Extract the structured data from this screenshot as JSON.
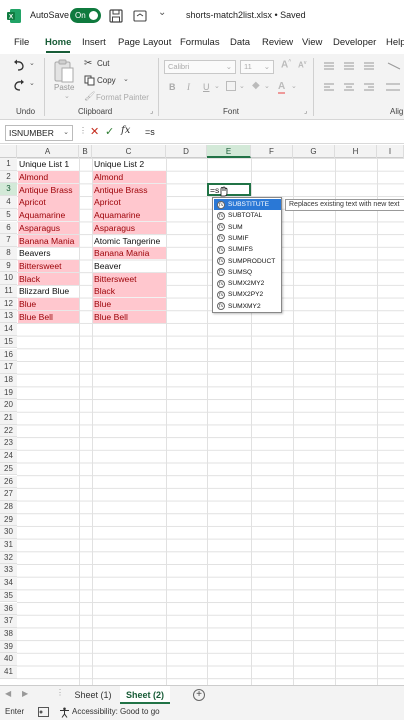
{
  "titlebar": {
    "autosave_label": "AutoSave",
    "toggle_state": "On",
    "doc_title": "shorts-match2list.xlsx • Saved",
    "chevron": "⌄"
  },
  "tabs": [
    "File",
    "Home",
    "Insert",
    "Page Layout",
    "Formulas",
    "Data",
    "Review",
    "View",
    "Developer",
    "Help"
  ],
  "ribbon": {
    "paste_label": "Paste",
    "cut_label": "Cut",
    "copy_label": "Copy",
    "format_painter_label": "Format Painter",
    "font_name": "Calibri",
    "font_size": "11",
    "bold": "B",
    "italic": "I",
    "underline": "U",
    "undo_group": "Undo",
    "clipboard_group": "Clipboard",
    "font_group": "Font",
    "alignment_group": "Alig"
  },
  "formula_bar": {
    "name_box": "ISNUMBER",
    "fx_label": "fx",
    "formula": "=s"
  },
  "columns": [
    "A",
    "B",
    "C",
    "D",
    "E",
    "F",
    "G",
    "H",
    "I"
  ],
  "rows": [
    "1",
    "2",
    "3",
    "4",
    "5",
    "6",
    "7",
    "8",
    "9",
    "10",
    "11",
    "12",
    "13",
    "14",
    "15",
    "16",
    "17",
    "18",
    "19",
    "20",
    "21",
    "22",
    "23",
    "24",
    "25",
    "26",
    "27",
    "28",
    "29",
    "30",
    "31",
    "32",
    "33",
    "34",
    "35",
    "36",
    "37",
    "38",
    "39",
    "40",
    "41"
  ],
  "cells": {
    "a1": "Unique List 1",
    "a2": "Almond",
    "a3": "Antique Brass",
    "a4": "Apricot",
    "a5": "Aquamarine",
    "a6": "Asparagus",
    "a7": "Banana Mania",
    "a8": "Beavers",
    "a9": "Bittersweet",
    "a10": "Black",
    "a11": "Blizzard Blue",
    "a12": "Blue",
    "a13": "Blue Bell",
    "c1": "Unique List 2",
    "c2": "Almond",
    "c3": "Antique Brass",
    "c4": "Apricot",
    "c5": "Aquamarine",
    "c6": "Asparagus",
    "c7": "Atomic Tangerine",
    "c8": "Banana Mania",
    "c9": "Beaver",
    "c10": "Bittersweet",
    "c11": "Black",
    "c12": "Blue",
    "c13": "Blue Bell",
    "e3": "=s"
  },
  "autocomplete": {
    "items": [
      "SUBSTITUTE",
      "SUBTOTAL",
      "SUM",
      "SUMIF",
      "SUMIFS",
      "SUMPRODUCT",
      "SUMSQ",
      "SUMX2MY2",
      "SUMX2PY2",
      "SUMXMY2"
    ],
    "tooltip": "Replaces existing text with new text"
  },
  "sheets": {
    "tabs": [
      "Sheet (1)",
      "Sheet (2)"
    ],
    "active": "Sheet (2)"
  },
  "status": {
    "mode": "Enter",
    "accessibility": "Accessibility: Good to go"
  },
  "colors": {
    "accent": "#217346",
    "duplicate_fill": "#ffc7ce",
    "duplicate_text": "#9c0006",
    "autocomplete_highlight": "#2a78d6"
  }
}
